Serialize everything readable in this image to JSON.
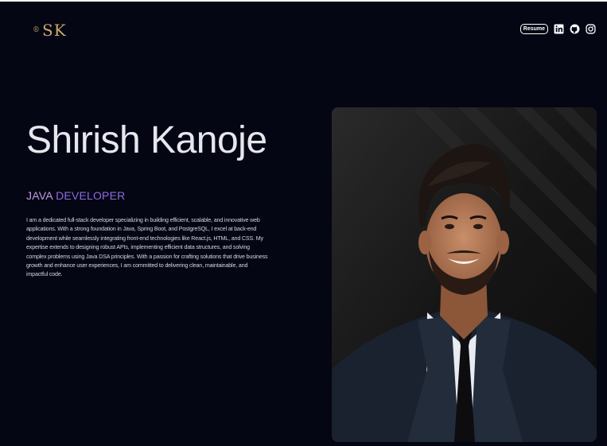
{
  "header": {
    "logo_mark": "®",
    "logo_text": "SK",
    "resume_label": "Resume",
    "social": [
      {
        "icon": "linkedin-icon"
      },
      {
        "icon": "github-icon"
      },
      {
        "icon": "instagram-icon"
      }
    ]
  },
  "hero": {
    "name": "Shirish Kanoje",
    "role_part1": "JAVA",
    "role_part2": "DEVELOPER",
    "bio": "I am a dedicated full-stack developer specializing in building efficient, scalable, and innovative web applications. With a strong foundation in Java, Spring Boot, and PostgreSQL, I excel at back-end development while seamlessly integrating front-end technologies like React.js, HTML, and CSS. My expertise extends to designing robust APIs, implementing efficient data structures, and solving complex problems using Java DSA principles. With a passion for crafting solutions that drive business growth and enhance user experiences, I am committed to delivering clean, maintainable, and impactful code."
  },
  "colors": {
    "background": "#040614",
    "logo_gold": "#caa86a",
    "role_light": "#c39be6",
    "role_dark": "#8f6adf"
  }
}
